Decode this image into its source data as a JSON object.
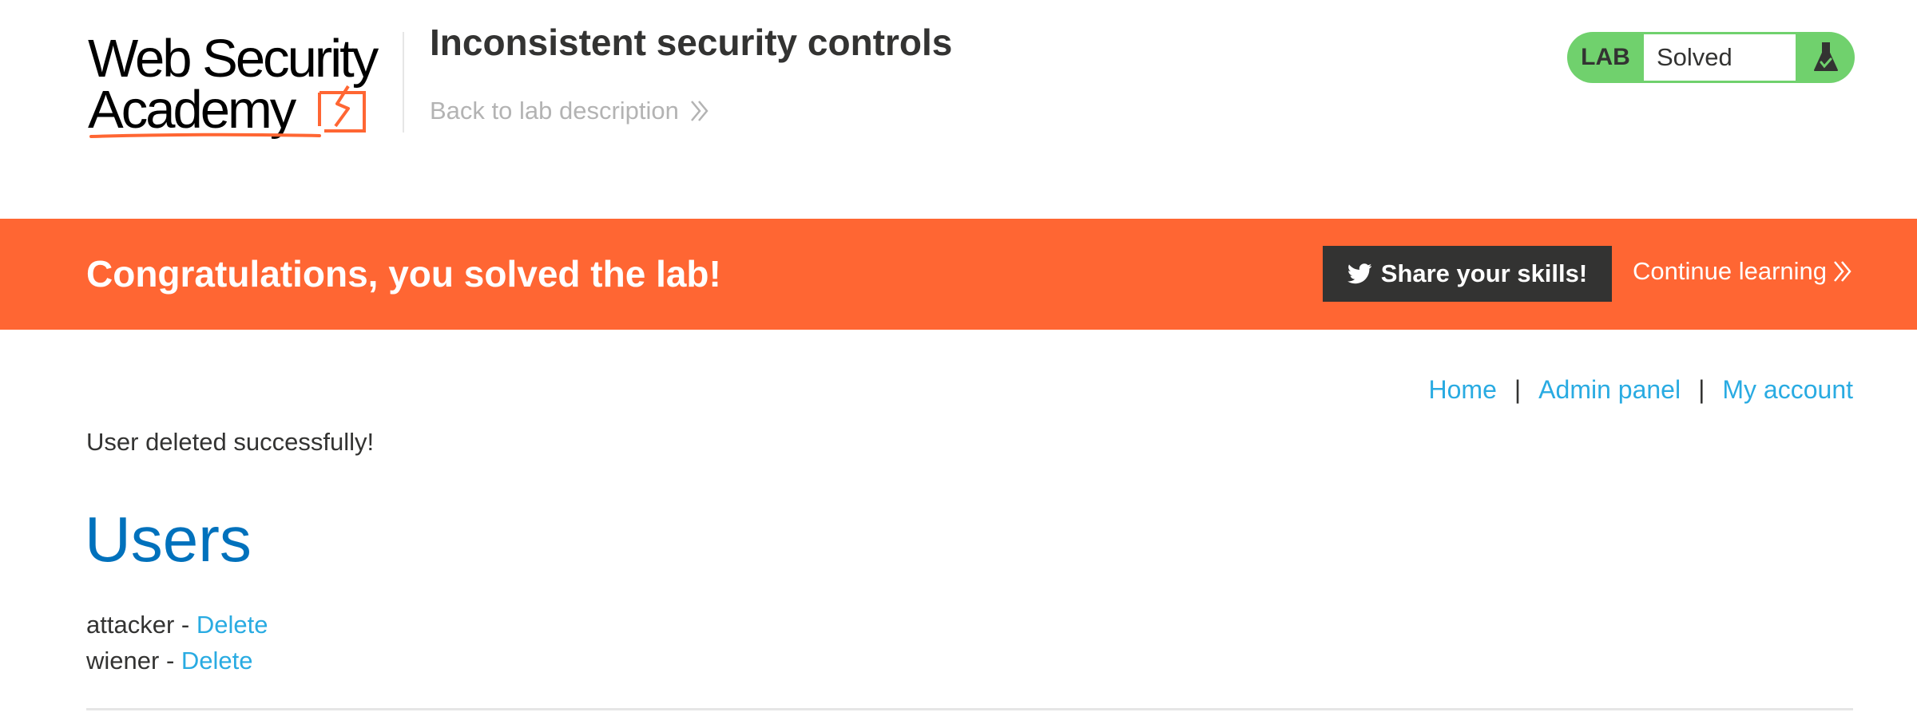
{
  "header": {
    "logo": {
      "line1": "Web Security",
      "line2": "Academy"
    },
    "lab_title": "Inconsistent security controls",
    "back_link": "Back to lab description",
    "lab_status": {
      "label": "LAB",
      "state": "Solved",
      "icon": "flask-icon"
    }
  },
  "banner": {
    "message": "Congratulations, you solved the lab!",
    "share_label": "Share your skills!",
    "share_icon": "twitter-bird-icon",
    "continue_label": "Continue learning"
  },
  "nav": {
    "items": [
      {
        "label": "Home"
      },
      {
        "label": "Admin panel"
      },
      {
        "label": "My account"
      }
    ],
    "separator": "|"
  },
  "main": {
    "message": "User deleted successfully!",
    "heading": "Users",
    "users": [
      {
        "name": "attacker",
        "separator": " - ",
        "action": "Delete"
      },
      {
        "name": "wiener",
        "separator": " - ",
        "action": "Delete"
      }
    ]
  },
  "colors": {
    "accent_orange": "#ff6633",
    "status_green": "#70d16d",
    "link_blue": "#29abe2",
    "heading_blue": "#0071bc",
    "dark_button": "#333332"
  }
}
